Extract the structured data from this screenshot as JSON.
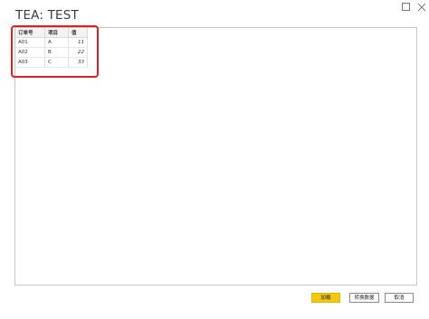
{
  "window": {
    "title": "TEA: TEST",
    "maximize_icon": "maximize-icon",
    "close_icon": "close-icon"
  },
  "preview_table": {
    "columns": [
      "订单号",
      "项目",
      "值"
    ],
    "rows": [
      [
        "A01",
        "A",
        "11"
      ],
      [
        "A02",
        "B",
        "22"
      ],
      [
        "A03",
        "C",
        "33"
      ]
    ]
  },
  "buttons": {
    "load": "加载",
    "transform": "转换数据",
    "cancel": "取消"
  },
  "colors": {
    "load_button": "#f2c811",
    "highlight_border": "#e02020"
  }
}
